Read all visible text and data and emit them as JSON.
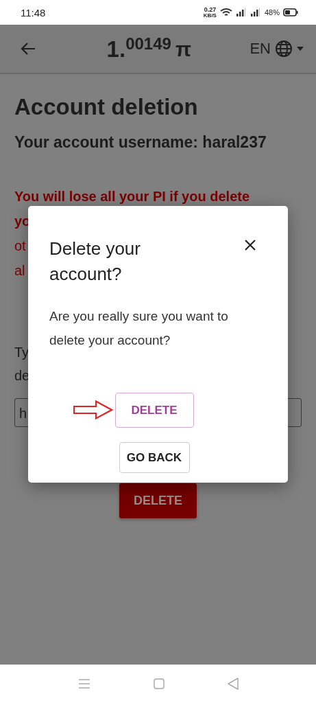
{
  "status_bar": {
    "time": "11:48",
    "speed": "0.27",
    "speed_unit": "KB/S",
    "battery": "48%"
  },
  "app_bar": {
    "balance_whole": "1.",
    "balance_fraction": "00149",
    "currency": "π",
    "language": "EN"
  },
  "page": {
    "title": "Account deletion",
    "username_line": "Your account username: haral237",
    "warning_lines": [
      {
        "text": "You will lose all your PI if you delete",
        "bold": true
      },
      {
        "text": "yo",
        "bold": true
      },
      {
        "text": "ot",
        "bold": false
      },
      {
        "text": "al",
        "bold": false
      }
    ],
    "instruction_lines": [
      "Ty",
      "de"
    ],
    "input_value": "h",
    "delete_button": "DELETE"
  },
  "dialog": {
    "title": "Delete your account?",
    "message": "Are you really sure you want to delete your account?",
    "confirm_button": "DELETE",
    "cancel_button": "GO BACK"
  }
}
